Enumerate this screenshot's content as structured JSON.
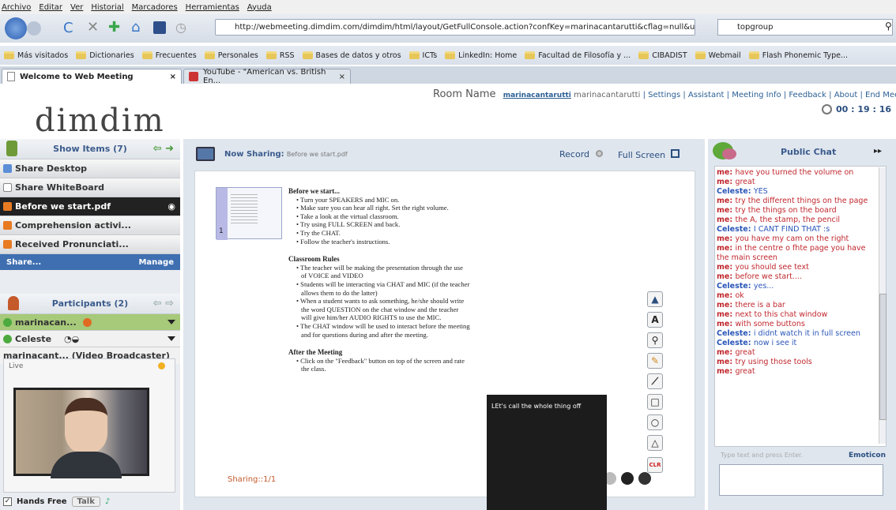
{
  "browser": {
    "menu": [
      "Archivo",
      "Editar",
      "Ver",
      "Historial",
      "Marcadores",
      "Herramientas",
      "Ayuda"
    ],
    "url": "http://webmeeting.dimdim.com/dimdim/html/layout/GetFullConsole.action?confKey=marinacantarutti&cflag=null&uri=",
    "search": "topgroup",
    "bookmarks": [
      "Más visitados",
      "Dictionaries",
      "Frecuentes",
      "Personales",
      "RSS",
      "Bases de datos y otros",
      "ICTs",
      "LinkedIn: Home",
      "Facultad de Filosofía y ...",
      "CIBADIST",
      "Webmail",
      "Flash Phonemic Type..."
    ],
    "tabs": [
      {
        "title": "Welcome to Web Meeting",
        "close": "×"
      },
      {
        "title": "YouTube - \"American vs. British En...",
        "close": "×"
      }
    ]
  },
  "header": {
    "logo": "dimdim",
    "room_label": "Room Name",
    "room_key": "marinacantarutti",
    "room_name": "marinacantarutti",
    "links": [
      "Settings",
      "Assistant",
      "Meeting Info",
      "Feedback",
      "About",
      "End Meetin"
    ],
    "timer": "00 : 19 : 16"
  },
  "left": {
    "show_items_title": "Show Items (7)",
    "items": [
      "Share Desktop",
      "Share WhiteBoard",
      "Before we start.pdf",
      "Comprehension activi...",
      "Received Pronunciati..."
    ],
    "share_label": "Share...",
    "manage_label": "Manage",
    "participants_title": "Participants (2)",
    "participants": [
      "marinacan...",
      "Celeste"
    ],
    "broadcaster": "marinacant... (Video Broadcaster)",
    "live_label": "Live",
    "hands_free": "Hands Free",
    "talk": "Talk"
  },
  "center": {
    "now_sharing_label": "Now Sharing:",
    "now_sharing_file": "Before we start.pdf",
    "record": "Record",
    "full_screen": "Full Screen",
    "sharing_status": "Sharing::1/1",
    "thumb_number": "1",
    "slide": {
      "title": "Before we start...",
      "bullets1": [
        "Turn your SPEAKERS and MIC on.",
        "Make sure you can hear all right. Set the right volume.",
        "Take a look at the virtual classroom.",
        "Try using FULL SCREEN and back.",
        "Try the CHAT.",
        "Follow the teacher's instructions."
      ],
      "rules_title": "Classroom Rules",
      "bullets2": [
        "The teacher will be making the presentation through the use of VOICE and VIDEO",
        "Students will be interacting via CHAT and MIC (if the teacher allows them to do the latter)",
        "When a student wants to ask something, he/she should write the word QUESTION on the chat window and the teacher will give him/her AUDIO RIGHTS to use the MIC.",
        "The CHAT window will be used to interact before the meeting and for questions during and after the meeting."
      ],
      "after_title": "After the Meeting",
      "bullets3": [
        "Click on the \"Feedback\" button on top of the screen and rate the class."
      ]
    },
    "tools": [
      "▲",
      "A",
      "⚲",
      "✎",
      "⟋",
      "□",
      "○",
      "△",
      "CLR"
    ],
    "tooltip": "LEt's call the whole thing off"
  },
  "chat": {
    "title": "Public Chat",
    "messages": [
      {
        "who": "me",
        "text": "have you turned the volume on"
      },
      {
        "who": "me",
        "text": "great"
      },
      {
        "who": "Celeste",
        "text": "YES"
      },
      {
        "who": "me",
        "text": "try the different things on the page"
      },
      {
        "who": "me",
        "text": "try the things on the board"
      },
      {
        "who": "me",
        "text": "the A, the stamp, the pencil"
      },
      {
        "who": "Celeste",
        "text": "I CANT FIND THAT :s"
      },
      {
        "who": "me",
        "text": "you have my cam on the right"
      },
      {
        "who": "me",
        "text": "in the centre o fhte page you have the main screen"
      },
      {
        "who": "me",
        "text": "you should see text"
      },
      {
        "who": "me",
        "text": "before we start...."
      },
      {
        "who": "Celeste",
        "text": "yes..."
      },
      {
        "who": "me",
        "text": "ok"
      },
      {
        "who": "me",
        "text": "there is a bar"
      },
      {
        "who": "me",
        "text": "next to this chat window"
      },
      {
        "who": "me",
        "text": "with some buttons"
      },
      {
        "who": "Celeste",
        "text": "i didnt watch it in full screen"
      },
      {
        "who": "Celeste",
        "text": "now i see it"
      },
      {
        "who": "me",
        "text": "great"
      },
      {
        "who": "me",
        "text": "try using those tools"
      },
      {
        "who": "me",
        "text": "great"
      }
    ],
    "input_placeholder": "Type text and press Enter.",
    "emoticon": "Emoticon"
  }
}
